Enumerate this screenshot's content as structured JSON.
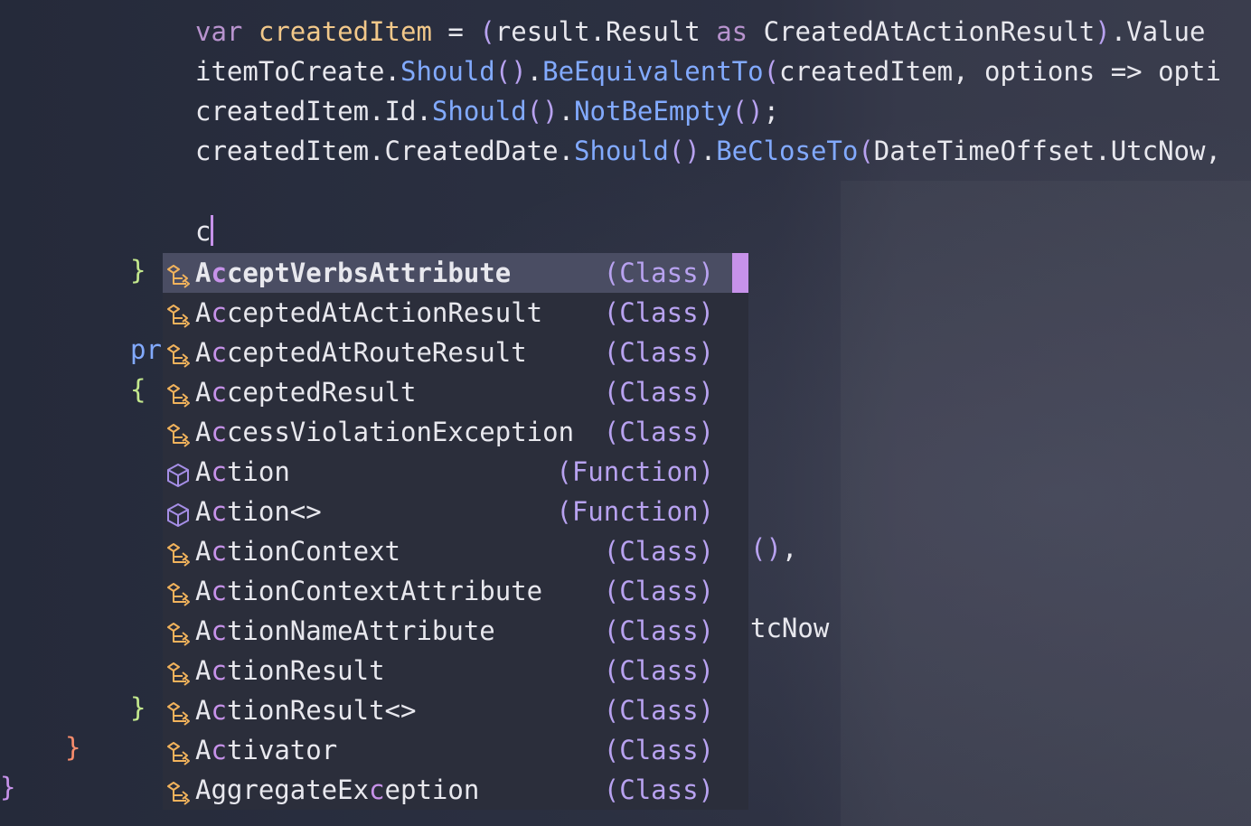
{
  "editor": {
    "line1": {
      "kw_var": "var",
      "ident": "createdItem",
      "eq": " = ",
      "paren_open": "(",
      "expr": "result.Result ",
      "kw_as": "as",
      "type": " CreatedAtActionResult",
      "paren_close": ")",
      "tail": ".Value"
    },
    "line2": {
      "obj": "itemToCreate.",
      "m1": "Should",
      "p1": "()",
      "dot": ".",
      "m2": "BeEquivalentTo",
      "p2": "(",
      "args": "createdItem, options => opti"
    },
    "line3": {
      "obj": "createdItem.Id.",
      "m1": "Should",
      "p1": "()",
      "dot": ".",
      "m2": "NotBeEmpty",
      "p2": "()",
      "semi": ";"
    },
    "line4": {
      "obj": "createdItem.CreatedDate.",
      "m1": "Should",
      "p1": "()",
      "dot": ".",
      "m2": "BeCloseTo",
      "p2": "(",
      "args": "DateTimeOffset.UtcNow,"
    },
    "typed": "c",
    "gutter_left": {
      "brace_close_1": "}",
      "pr": "pr",
      "brace_open": "{",
      "brace_close_2": "}",
      "brace_close_3": "}",
      "brace_close_4": "}"
    },
    "peek_right": {
      "parens": "()",
      "comma": ",",
      "utcnow": "tcNow"
    }
  },
  "completion": {
    "items": [
      {
        "pre": "A",
        "match": "c",
        "post": "ceptVerbsAttribute",
        "kind": "(Class)",
        "icon": "class-icon",
        "selected": true
      },
      {
        "pre": "A",
        "match": "c",
        "post": "ceptedAtActionResult",
        "kind": "(Class)",
        "icon": "class-icon"
      },
      {
        "pre": "A",
        "match": "c",
        "post": "ceptedAtRouteResult",
        "kind": "(Class)",
        "icon": "class-icon"
      },
      {
        "pre": "A",
        "match": "c",
        "post": "ceptedResult",
        "kind": "(Class)",
        "icon": "class-icon"
      },
      {
        "pre": "A",
        "match": "c",
        "post": "cessViolationException",
        "kind": "(Class)",
        "icon": "class-icon"
      },
      {
        "pre": "A",
        "match": "c",
        "post": "tion",
        "kind": "(Function)",
        "icon": "function-icon"
      },
      {
        "pre": "A",
        "match": "c",
        "post": "tion<>",
        "kind": "(Function)",
        "icon": "function-icon"
      },
      {
        "pre": "A",
        "match": "c",
        "post": "tionContext",
        "kind": "(Class)",
        "icon": "class-icon"
      },
      {
        "pre": "A",
        "match": "c",
        "post": "tionContextAttribute",
        "kind": "(Class)",
        "icon": "class-icon"
      },
      {
        "pre": "A",
        "match": "c",
        "post": "tionNameAttribute",
        "kind": "(Class)",
        "icon": "class-icon"
      },
      {
        "pre": "A",
        "match": "c",
        "post": "tionResult",
        "kind": "(Class)",
        "icon": "class-icon"
      },
      {
        "pre": "A",
        "match": "c",
        "post": "tionResult<>",
        "kind": "(Class)",
        "icon": "class-icon"
      },
      {
        "pre": "A",
        "match": "c",
        "post": "tivator",
        "kind": "(Class)",
        "icon": "class-icon"
      },
      {
        "pre": "AggregateEx",
        "match": "c",
        "post": "eption",
        "kind": "(Class)",
        "icon": "class-icon"
      }
    ]
  },
  "colors": {
    "accent": "#c792ea",
    "class_icon": "#f2b35c",
    "function_icon": "#a58ee6",
    "kind_text": "#b8a2f0"
  }
}
